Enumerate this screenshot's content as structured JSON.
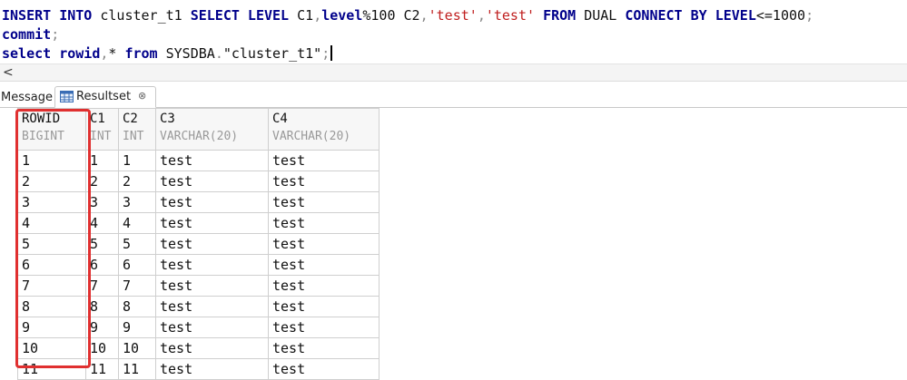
{
  "editor": {
    "lines": [
      [
        {
          "t": "INSERT INTO",
          "c": "kw"
        },
        {
          "t": " cluster_t1 ",
          "c": ""
        },
        {
          "t": "SELECT LEVEL",
          "c": "kw"
        },
        {
          "t": " C1",
          "c": ""
        },
        {
          "t": ",",
          "c": "punct"
        },
        {
          "t": "level",
          "c": "kw"
        },
        {
          "t": "%100 C2",
          "c": ""
        },
        {
          "t": ",",
          "c": "punct"
        },
        {
          "t": "'test'",
          "c": "str"
        },
        {
          "t": ",",
          "c": "punct"
        },
        {
          "t": "'test'",
          "c": "str"
        },
        {
          "t": " ",
          "c": ""
        },
        {
          "t": "FROM",
          "c": "kw"
        },
        {
          "t": " DUAL ",
          "c": ""
        },
        {
          "t": "CONNECT BY LEVEL",
          "c": "kw"
        },
        {
          "t": "<=1000",
          "c": ""
        },
        {
          "t": ";",
          "c": "punct"
        }
      ],
      [
        {
          "t": "commit",
          "c": "kw"
        },
        {
          "t": ";",
          "c": "punct"
        }
      ],
      [
        {
          "t": "select rowid",
          "c": "kw"
        },
        {
          "t": ",",
          "c": "punct"
        },
        {
          "t": "* ",
          "c": ""
        },
        {
          "t": "from",
          "c": "kw"
        },
        {
          "t": " SYSDBA",
          "c": ""
        },
        {
          "t": ".",
          "c": "punct"
        },
        {
          "t": "\"cluster_t1\"",
          "c": ""
        },
        {
          "t": ";",
          "c": "punct"
        }
      ]
    ]
  },
  "tabs": {
    "message_label": "Message",
    "resultset_label": "Resultset",
    "close_glyph": "⊗"
  },
  "resultset": {
    "columns": [
      {
        "name": "ROWID",
        "type": "BIGINT"
      },
      {
        "name": "C1",
        "type": "INT"
      },
      {
        "name": "C2",
        "type": "INT"
      },
      {
        "name": "C3",
        "type": "VARCHAR(20)"
      },
      {
        "name": "C4",
        "type": "VARCHAR(20)"
      }
    ],
    "rows": [
      [
        "1",
        "1",
        "1",
        "test",
        "test"
      ],
      [
        "2",
        "2",
        "2",
        "test",
        "test"
      ],
      [
        "3",
        "3",
        "3",
        "test",
        "test"
      ],
      [
        "4",
        "4",
        "4",
        "test",
        "test"
      ],
      [
        "5",
        "5",
        "5",
        "test",
        "test"
      ],
      [
        "6",
        "6",
        "6",
        "test",
        "test"
      ],
      [
        "7",
        "7",
        "7",
        "test",
        "test"
      ],
      [
        "8",
        "8",
        "8",
        "test",
        "test"
      ],
      [
        "9",
        "9",
        "9",
        "test",
        "test"
      ],
      [
        "10",
        "10",
        "10",
        "test",
        "test"
      ],
      [
        "11",
        "11",
        "11",
        "test",
        "test"
      ]
    ]
  },
  "colors": {
    "keyword": "#00008b",
    "string": "#c02020",
    "highlight": "#e03030"
  }
}
